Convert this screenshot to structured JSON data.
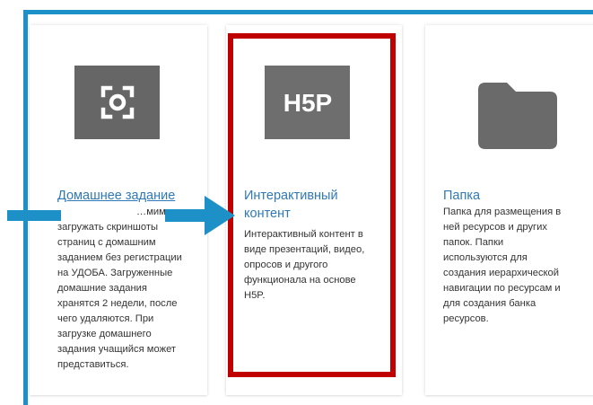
{
  "cards": [
    {
      "title": "Домашнее задание",
      "description": [
        "…мимся",
        "загружать скриншоты",
        "страниц с домашним",
        "заданием без регистрации",
        "на УДОБА. Загруженные",
        "домашние задания",
        "хранятся 2 недели, после",
        "чего удаляются. При",
        "загрузке домашнего",
        "задания учащийся может",
        "представиться."
      ],
      "icon": "screenshot-icon"
    },
    {
      "title_lines": [
        "Интерактивный",
        "контент"
      ],
      "description": [
        "Интерактивный контент в",
        "виде презентаций, видео,",
        "опросов и другого",
        "функционала на основе",
        "H5P."
      ],
      "icon": "h5p-logo-icon",
      "logo_text": "H5P"
    },
    {
      "title": "Папка",
      "description": [
        "Папка для размещения в",
        "ней ресурсов и других",
        "папок. Папки",
        "используются для",
        "создания иерархической",
        "навигации по ресурсам и",
        "для создания банка",
        "ресурсов."
      ],
      "icon": "folder-icon"
    }
  ],
  "annotations": {
    "arrow_color": "#1e90c8",
    "highlight_color": "#c00000",
    "frame_color": "#1e90c8"
  }
}
